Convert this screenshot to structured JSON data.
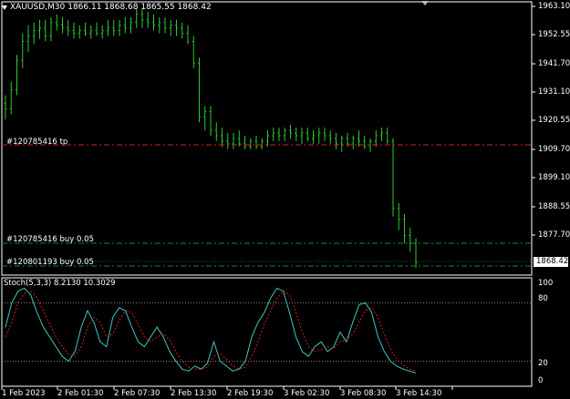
{
  "header": {
    "symbol": "XAUUSD,M30",
    "ohlc": "1866.11 1868.68 1865.55 1868.42"
  },
  "orders": [
    {
      "label": "#120785416 tp",
      "color": "#d32020"
    },
    {
      "label": "#120785416 buy 0.05",
      "color": "#0e8a2e"
    },
    {
      "label": "#120801193 buy 0.05",
      "color": "#0e8a2e"
    }
  ],
  "price_axis": {
    "ticks": [
      "1963.10",
      "1952.55",
      "1941.70",
      "1931.10",
      "1920.55",
      "1909.70",
      "1899.10",
      "1888.55",
      "1877.70"
    ],
    "current_price": "1868.42"
  },
  "indicator": {
    "label": "Stoch(5,3,3) 8.2130 10.3029",
    "ticks": [
      "100",
      "80",
      "20",
      "0"
    ],
    "main_color": "#3fc7c0",
    "signal_color": "#d32020"
  },
  "time_axis": [
    "1 Feb 2023",
    "2 Feb 01:30",
    "2 Feb 07:30",
    "2 Feb 13:30",
    "2 Feb 19:30",
    "3 Feb 02:30",
    "3 Feb 08:30",
    "3 Feb 14:30"
  ],
  "colors": {
    "background": "#000000",
    "candle": "#2ec82e",
    "grid": "#ffffff"
  },
  "chart_data": {
    "type": "candlestick",
    "ylim": [
      1866,
      1964
    ],
    "ohlc": [
      [
        1927,
        1930,
        1921,
        1925
      ],
      [
        1925,
        1935,
        1923,
        1932
      ],
      [
        1932,
        1945,
        1930,
        1943
      ],
      [
        1943,
        1953,
        1940,
        1950
      ],
      [
        1950,
        1956,
        1946,
        1952
      ],
      [
        1952,
        1957,
        1949,
        1954
      ],
      [
        1954,
        1958,
        1951,
        1955
      ],
      [
        1955,
        1958,
        1950,
        1952
      ],
      [
        1952,
        1959,
        1950,
        1957
      ],
      [
        1957,
        1960,
        1954,
        1956
      ],
      [
        1956,
        1959,
        1953,
        1955
      ],
      [
        1955,
        1958,
        1952,
        1954
      ],
      [
        1954,
        1957,
        1951,
        1953
      ],
      [
        1953,
        1956,
        1951,
        1954
      ],
      [
        1954,
        1957,
        1952,
        1953
      ],
      [
        1953,
        1956,
        1951,
        1954
      ],
      [
        1954,
        1957,
        1952,
        1953
      ],
      [
        1953,
        1956,
        1951,
        1954
      ],
      [
        1954,
        1958,
        1952,
        1955
      ],
      [
        1955,
        1958,
        1952,
        1954
      ],
      [
        1954,
        1958,
        1952,
        1956
      ],
      [
        1956,
        1959,
        1953,
        1955
      ],
      [
        1955,
        1959,
        1953,
        1957
      ],
      [
        1957,
        1962,
        1955,
        1960
      ],
      [
        1960,
        1962,
        1955,
        1958
      ],
      [
        1958,
        1961,
        1955,
        1957
      ],
      [
        1957,
        1960,
        1954,
        1956
      ],
      [
        1956,
        1959,
        1953,
        1957
      ],
      [
        1957,
        1959,
        1953,
        1955
      ],
      [
        1955,
        1958,
        1952,
        1956
      ],
      [
        1956,
        1958,
        1952,
        1955
      ],
      [
        1955,
        1957,
        1951,
        1953
      ],
      [
        1953,
        1956,
        1949,
        1950
      ],
      [
        1950,
        1952,
        1940,
        1942
      ],
      [
        1942,
        1944,
        1920,
        1922
      ],
      [
        1922,
        1926,
        1917,
        1924
      ],
      [
        1924,
        1926,
        1915,
        1917
      ],
      [
        1917,
        1920,
        1913,
        1915
      ],
      [
        1915,
        1918,
        1911,
        1913
      ],
      [
        1913,
        1916,
        1910,
        1912
      ],
      [
        1912,
        1916,
        1910,
        1914
      ],
      [
        1914,
        1917,
        1911,
        1912
      ],
      [
        1912,
        1915,
        1910,
        1911
      ],
      [
        1911,
        1914,
        1910,
        1913
      ],
      [
        1913,
        1915,
        1910,
        1911
      ],
      [
        1911,
        1914,
        1910,
        1913
      ],
      [
        1913,
        1917,
        1911,
        1915
      ],
      [
        1915,
        1918,
        1913,
        1916
      ],
      [
        1916,
        1918,
        1913,
        1915
      ],
      [
        1915,
        1918,
        1913,
        1917
      ],
      [
        1917,
        1919,
        1914,
        1916
      ],
      [
        1916,
        1918,
        1913,
        1915
      ],
      [
        1915,
        1918,
        1912,
        1916
      ],
      [
        1916,
        1918,
        1913,
        1914
      ],
      [
        1914,
        1917,
        1912,
        1915
      ],
      [
        1915,
        1918,
        1912,
        1916
      ],
      [
        1916,
        1918,
        1913,
        1915
      ],
      [
        1915,
        1917,
        1912,
        1914
      ],
      [
        1914,
        1916,
        1910,
        1912
      ],
      [
        1912,
        1915,
        1909,
        1914
      ],
      [
        1914,
        1916,
        1911,
        1912
      ],
      [
        1912,
        1915,
        1910,
        1914
      ],
      [
        1914,
        1917,
        1911,
        1913
      ],
      [
        1913,
        1915,
        1910,
        1911
      ],
      [
        1911,
        1914,
        1909,
        1913
      ],
      [
        1913,
        1917,
        1911,
        1915
      ],
      [
        1915,
        1918,
        1913,
        1916
      ],
      [
        1916,
        1918,
        1912,
        1913
      ],
      [
        1913,
        1914,
        1885,
        1888
      ],
      [
        1888,
        1890,
        1880,
        1884
      ],
      [
        1884,
        1886,
        1875,
        1878
      ],
      [
        1878,
        1881,
        1872,
        1875
      ],
      [
        1875,
        1877,
        1866,
        1868
      ]
    ],
    "orders_price": [
      1912.5,
      1875.5,
      1867.5
    ],
    "stoch_main": [
      55,
      80,
      92,
      95,
      88,
      70,
      55,
      45,
      35,
      25,
      20,
      30,
      55,
      72,
      60,
      40,
      35,
      65,
      75,
      72,
      55,
      40,
      35,
      45,
      55,
      45,
      30,
      20,
      12,
      10,
      15,
      12,
      18,
      40,
      20,
      15,
      10,
      12,
      20,
      45,
      60,
      70,
      85,
      95,
      92,
      70,
      45,
      30,
      25,
      35,
      40,
      30,
      35,
      50,
      40,
      60,
      78,
      80,
      70,
      45,
      30,
      20,
      15,
      12,
      10,
      8
    ],
    "stoch_signal": [
      45,
      60,
      80,
      90,
      92,
      85,
      72,
      58,
      45,
      35,
      27,
      25,
      35,
      55,
      65,
      60,
      45,
      48,
      62,
      72,
      70,
      58,
      45,
      40,
      45,
      48,
      42,
      30,
      20,
      14,
      12,
      12,
      14,
      25,
      28,
      22,
      15,
      12,
      14,
      25,
      40,
      58,
      72,
      85,
      92,
      88,
      70,
      50,
      35,
      30,
      32,
      35,
      33,
      40,
      42,
      48,
      60,
      72,
      75,
      65,
      48,
      32,
      22,
      16,
      12,
      10
    ]
  }
}
